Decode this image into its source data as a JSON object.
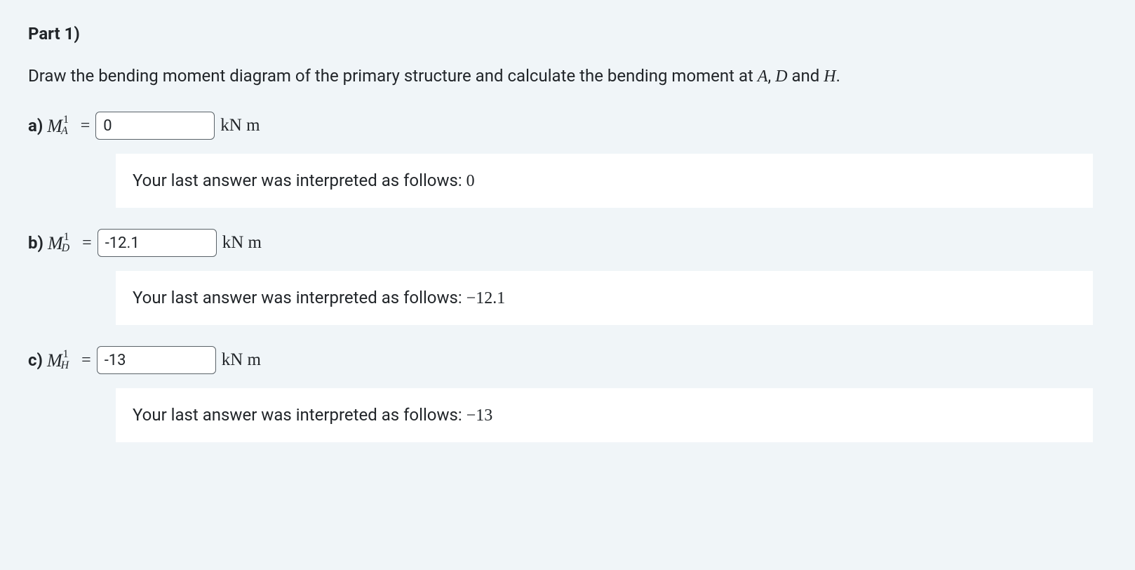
{
  "part": {
    "title": "Part 1)",
    "instruction_start": "Draw the bending moment diagram of the primary structure and calculate the bending moment at ",
    "instruction_points": [
      "A",
      "D",
      "H"
    ],
    "instruction_and": ", ",
    "instruction_and2": " and ",
    "instruction_end": "."
  },
  "questions": [
    {
      "label": "a)",
      "symbol_main": "M",
      "symbol_sup": "1",
      "symbol_sub": "A",
      "value": "0",
      "unit": "kN m",
      "feedback_prefix": "Your last answer was interpreted as follows: ",
      "feedback_value": "0"
    },
    {
      "label": "b)",
      "symbol_main": "M",
      "symbol_sup": "1",
      "symbol_sub": "D",
      "value": "-12.1",
      "unit": "kN m",
      "feedback_prefix": "Your last answer was interpreted as follows: ",
      "feedback_value": "−12.1"
    },
    {
      "label": "c)",
      "symbol_main": "M",
      "symbol_sup": "1",
      "symbol_sub": "H",
      "value": "-13",
      "unit": "kN m",
      "feedback_prefix": "Your last answer was interpreted as follows: ",
      "feedback_value": "−13"
    }
  ]
}
